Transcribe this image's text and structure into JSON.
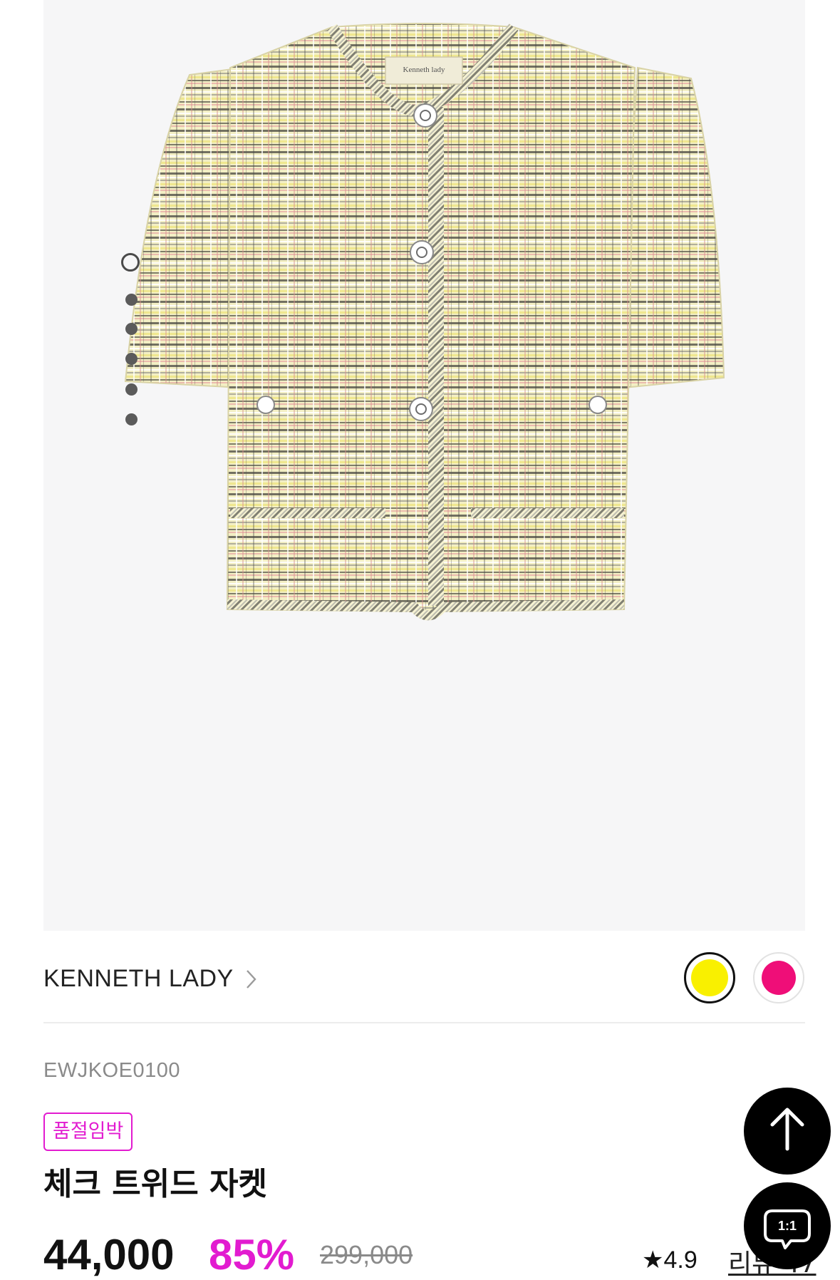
{
  "gallery": {
    "image_alt": "체크 트위드 자켓",
    "label_text": "Kenneth lady",
    "slides_total": 6,
    "active_slide": 1
  },
  "brand": {
    "name": "KENNETH LADY",
    "chevron_icon": "chevron-right-icon"
  },
  "colors": {
    "swatches": [
      {
        "name": "yellow",
        "hex": "#f9f000",
        "selected": true
      },
      {
        "name": "pink",
        "hex": "#ef0e78",
        "selected": false
      }
    ],
    "accent": "#e21bd0"
  },
  "product": {
    "sku": "EWJKOE0100",
    "badge": "품절임박",
    "title": "체크 트위드 자켓",
    "price": "44,000",
    "discount": "85%",
    "original_price": "299,000",
    "rating_icon": "star-icon",
    "rating": "4.9",
    "review_link": "리뷰 47"
  },
  "fabs": {
    "top_icon": "arrow-up-icon",
    "chat_icon": "chat-icon",
    "chat_label": "1:1"
  }
}
